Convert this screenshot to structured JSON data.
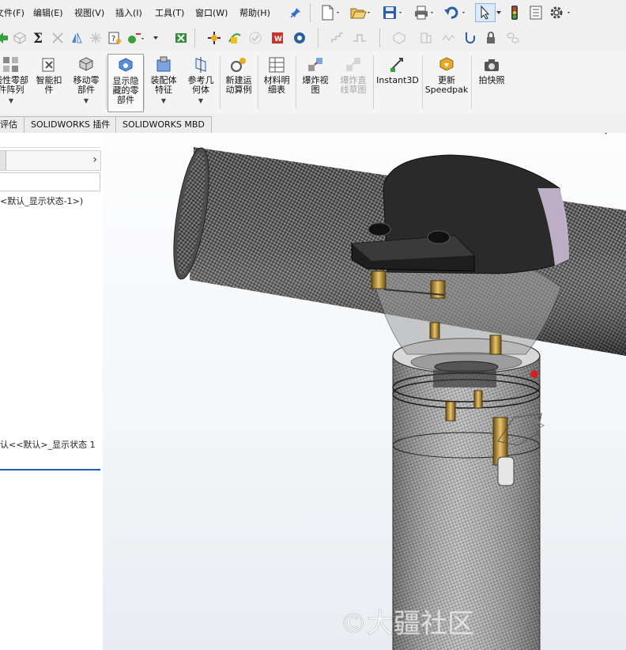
{
  "menu": {
    "items": [
      "文件(F)",
      "编辑(E)",
      "视图(V)",
      "插入(I)",
      "工具(T)",
      "窗口(W)",
      "帮助(H)"
    ]
  },
  "commands": [
    {
      "label": "线性零部\n件阵列",
      "has_arrow": true,
      "enabled": true
    },
    {
      "label": "智能扣\n件",
      "has_arrow": false,
      "enabled": true
    },
    {
      "label": "移动零\n部件",
      "has_arrow": true,
      "enabled": true
    },
    {
      "label": "显示隐\n藏的零\n部件",
      "has_arrow": false,
      "enabled": true,
      "selected": true
    },
    {
      "label": "装配体\n特征",
      "has_arrow": true,
      "enabled": true
    },
    {
      "label": "参考几\n何体",
      "has_arrow": true,
      "enabled": true
    },
    {
      "label": "新建运\n动算例",
      "has_arrow": false,
      "enabled": true
    },
    {
      "label": "材料明\n细表",
      "has_arrow": false,
      "enabled": true
    },
    {
      "label": "爆炸视\n图",
      "has_arrow": false,
      "enabled": true
    },
    {
      "label": "爆炸直\n线草图",
      "has_arrow": false,
      "enabled": false
    },
    {
      "label": "Instant3D",
      "has_arrow": false,
      "enabled": true
    },
    {
      "label": "更新\nSpeedpak",
      "has_arrow": false,
      "enabled": true
    },
    {
      "label": "拍快照",
      "has_arrow": false,
      "enabled": true
    }
  ],
  "tabs": [
    "评估",
    "SOLIDWORKS 插件",
    "SOLIDWORKS MBD"
  ],
  "left_panel": {
    "config_line": "<默认_显示状态-1>)",
    "config_bottom": "认<<默认>_显示状态 1"
  },
  "watermark": "©大疆社区",
  "colors": {
    "accent_blue": "#1f5fb8",
    "toolbar_bg": "#f0f0f0",
    "tube_dark": "#3e3e3e",
    "clamp": "#2a2a2a",
    "brass": "#b58a3a"
  }
}
